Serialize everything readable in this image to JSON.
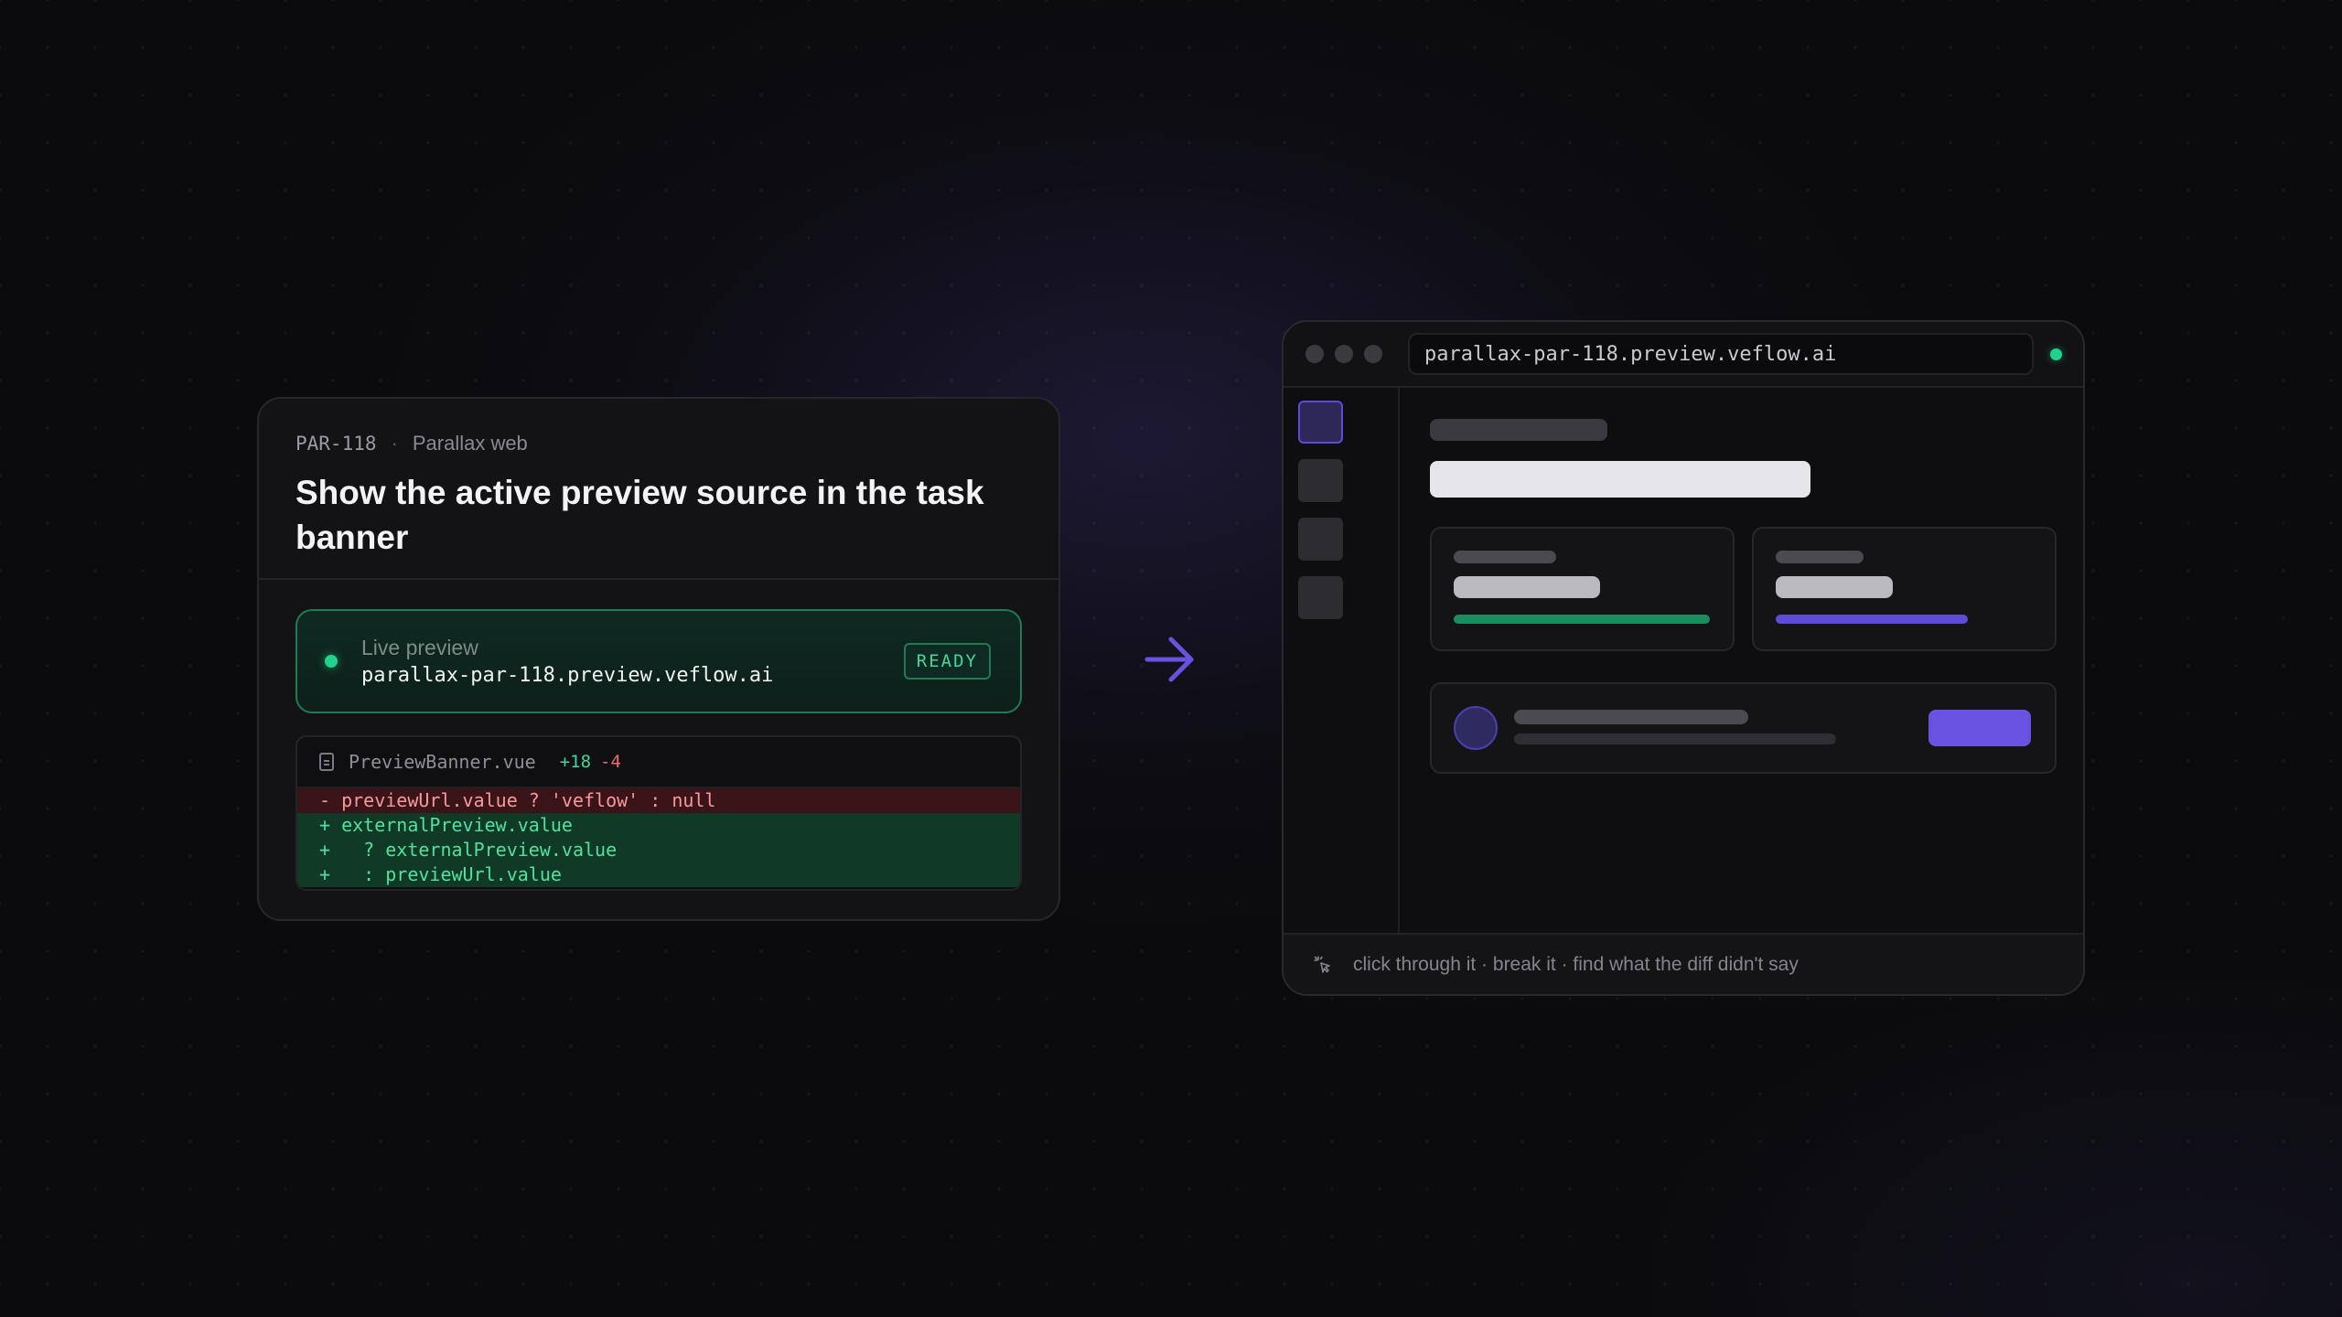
{
  "task": {
    "id": "PAR-118",
    "separator": "·",
    "project": "Parallax web",
    "title": "Show the active preview source in the task banner"
  },
  "preview": {
    "label": "Live preview",
    "url": "parallax-par-118.preview.veflow.ai",
    "status": "READY"
  },
  "diff": {
    "filename": "PreviewBanner.vue",
    "additions": "+18",
    "deletions": "-4",
    "lines": [
      {
        "type": "del",
        "text": "- previewUrl.value ? 'veflow' : null"
      },
      {
        "type": "add",
        "text": "+ externalPreview.value"
      },
      {
        "type": "add",
        "text": "+   ? externalPreview.value"
      },
      {
        "type": "add",
        "text": "+   : previewUrl.value"
      }
    ]
  },
  "browser": {
    "address": "parallax-par-118.preview.veflow.ai",
    "footer_text": "click through it · break it · find what the diff didn't say"
  },
  "colors": {
    "accent": "#6a52e0",
    "success": "#1fd38c",
    "deletion": "#f06c6c"
  },
  "icons": {
    "arrow": "arrow-right-icon",
    "file": "file-icon",
    "pointer": "click-pointer-icon"
  }
}
